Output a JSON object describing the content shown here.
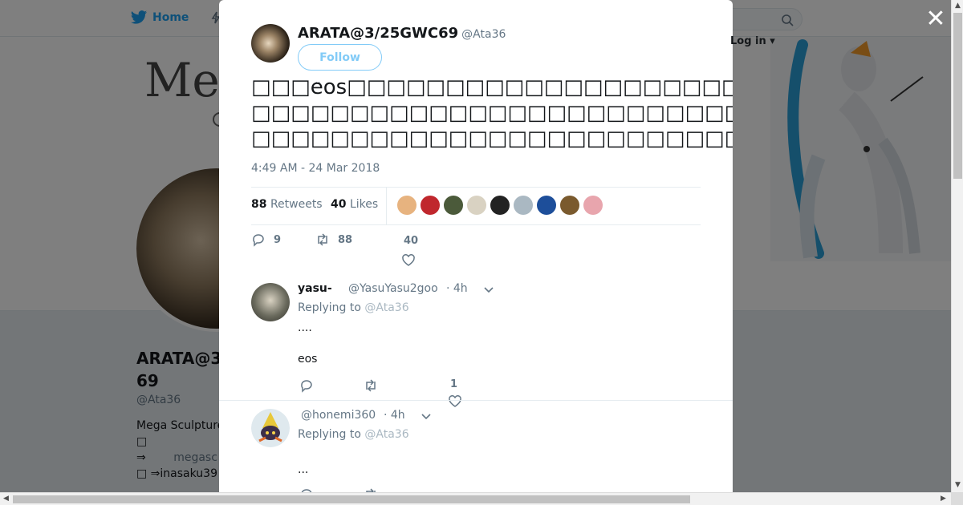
{
  "nav": {
    "home_label": "Home",
    "login_label": "Log in"
  },
  "banner": {
    "title_partial": "Meg"
  },
  "profile": {
    "name_line1": "ARATA@3",
    "name_line2": "69",
    "handle": "@Ata36",
    "bio_line1": "Mega Sculpture",
    "bio_line2": "□",
    "bio_line3_arrow": "⇒",
    "bio_line3_link": "megasc",
    "bio_line4": "□ ⇒inasaku39"
  },
  "modal": {
    "author_name": "ARATA@3/25GWC69",
    "author_handle": "@Ata36",
    "follow_label": "Follow",
    "tweet_lines": [
      "□□□eos□□□□□□□□□□□□□□□□□□□□□□□□□□□□□□□□□□□□□□□□",
      "□□□□□□□□□□□□□□□□□□□□□□□□□□□□□□□□□□□□□□□□□□□□□□□",
      "□□□□□□□□□□□□□□□□□□□□□□□□□□□□□□□□□□□□"
    ],
    "timestamp": "4:49 AM - 24 Mar 2018",
    "retweets_count": "88",
    "retweets_label": "Retweets",
    "likes_count": "40",
    "likes_label": "Likes",
    "likers": [
      {
        "icon": "avatar",
        "color": "#e7b37f"
      },
      {
        "icon": "avatar",
        "color": "#c0272d"
      },
      {
        "icon": "avatar",
        "color": "#4b5a3a"
      },
      {
        "icon": "avatar",
        "color": "#d9d2c2"
      },
      {
        "icon": "avatar",
        "color": "#222222"
      },
      {
        "icon": "avatar",
        "color": "#aab8c2"
      },
      {
        "icon": "avatar",
        "color": "#1d4e9a"
      },
      {
        "icon": "avatar",
        "color": "#7a5a2e"
      },
      {
        "icon": "avatar",
        "color": "#e8a5ad"
      }
    ],
    "action_replies": "9",
    "action_retweets": "88",
    "action_likes": "40",
    "replies": [
      {
        "name": "yasu-",
        "handle": "@YasuYasu2goo",
        "time": "· 4h",
        "replying_prefix": "Replying to",
        "replying_to": "@Ata36",
        "body_line1": "....",
        "body_line2": "eos",
        "like_count": "1",
        "avatar_color": "#6b6b5e"
      },
      {
        "name": "",
        "handle": "@honemi360",
        "time": "· 4h",
        "replying_prefix": "Replying to",
        "replying_to": "@Ata36",
        "body_line1": "...",
        "avatar_color": "#e8c83a"
      }
    ]
  },
  "colors": {
    "accent": "#1da1f2",
    "text": "#14171a",
    "muted": "#657786"
  }
}
